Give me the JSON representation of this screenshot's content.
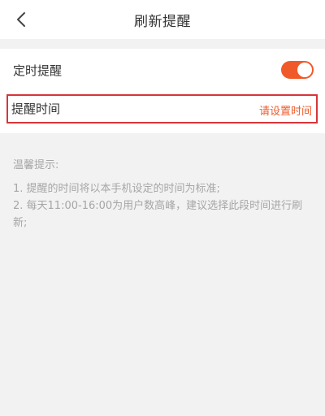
{
  "header": {
    "title": "刷新提醒",
    "back_icon": "chevron-left-icon"
  },
  "settings": {
    "schedule_label": "定时提醒",
    "schedule_enabled": true,
    "reminder_time_label": "提醒时间",
    "reminder_time_value": "请设置时间"
  },
  "tips": {
    "title": "温馨提示:",
    "items": [
      "1. 提醒的时间将以本手机设定的时间为标准;",
      "2. 每天11:00-16:00为用户数高峰，建议选择此段时间进行刷新;"
    ]
  },
  "colors": {
    "accent": "#f05a2a",
    "highlight_border": "#d8353a",
    "background": "#f2f2f2",
    "tip_text": "#a6a6a6"
  }
}
